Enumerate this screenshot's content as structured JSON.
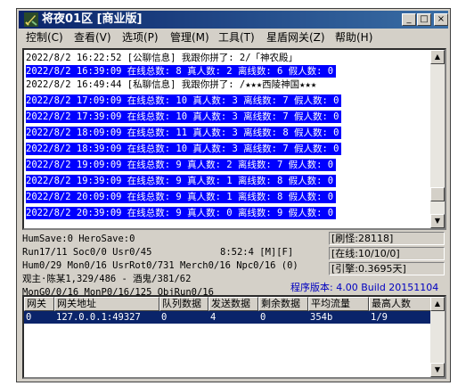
{
  "window": {
    "title": "将夜01区 [商业版]",
    "buttons": {
      "minimize": "_",
      "maximize": "□",
      "close": "×"
    }
  },
  "menu": [
    {
      "label": "控制(C)"
    },
    {
      "label": "查看(V)"
    },
    {
      "label": "选项(P)"
    },
    {
      "label": "管理(M)"
    },
    {
      "label": "工具(T)"
    },
    {
      "label": "星盾网关(Z)"
    },
    {
      "label": "帮助(H)"
    }
  ],
  "log": [
    {
      "text": "2022/8/2 16:22:52 [公聊信息] 我跟你拼了: 2/「神农殿」",
      "selected": false
    },
    {
      "text": "2022/8/2 16:39:09 在线总数: 8 真人数: 2 离线数: 6 假人数: 0",
      "selected": true
    },
    {
      "text": "2022/8/2 16:49:44 [私聊信息] 我跟你拼了: /★★★西陵神国★★★",
      "selected": false
    },
    {
      "text": "2022/8/2 17:09:09 在线总数: 10 真人数: 3 离线数: 7 假人数: 0",
      "selected": true
    },
    {
      "text": "2022/8/2 17:39:09 在线总数: 10 真人数: 3 离线数: 7 假人数: 0",
      "selected": true
    },
    {
      "text": "2022/8/2 18:09:09 在线总数: 11 真人数: 3 离线数: 8 假人数: 0",
      "selected": true
    },
    {
      "text": "2022/8/2 18:39:09 在线总数: 10 真人数: 3 离线数: 7 假人数: 0",
      "selected": true
    },
    {
      "text": "2022/8/2 19:09:09 在线总数: 9 真人数: 2 离线数: 7 假人数: 0",
      "selected": true
    },
    {
      "text": "2022/8/2 19:39:09 在线总数: 9 真人数: 1 离线数: 8 假人数: 0",
      "selected": true
    },
    {
      "text": "2022/8/2 20:09:09 在线总数: 9 真人数: 1 离线数: 8 假人数: 0",
      "selected": true
    },
    {
      "text": "2022/8/2 20:39:09 在线总数: 9 真人数: 0 离线数: 9 假人数: 0",
      "selected": true
    }
  ],
  "status": {
    "line1": "HumSave:0 HeroSave:0",
    "line2a": "Run17/11 Soc0/0 Usr0/45",
    "line2b": "8:52:4 [M][F]",
    "line3": "Hum0/29 Mon0/16 UsrRot0/731 Merch0/16 Npc0/16 (0)",
    "line4": "观主·陈某1,329/486 - 酒鬼/381/62",
    "line5": "MonG0/0/16 MonP0/16/125 ObjRun0/16",
    "monsters": "[刷怪:28118]",
    "online": "[在线:10/10/0]",
    "engine": "[引擎:0.3695天]",
    "version": "程序版本: 4.00 Build 20151104"
  },
  "gateway_table": {
    "columns": [
      "网关",
      "网关地址",
      "队列数据",
      "发送数据",
      "剩余数据",
      "平均流量",
      "最高人数"
    ],
    "rows": [
      [
        "0",
        "127.0.0.1:49327",
        "0",
        "4",
        "0",
        "354b",
        "1/9"
      ]
    ]
  },
  "colors": {
    "title_bar": "#0a246a",
    "selection": "#0000ff",
    "version_text": "#0000c0"
  }
}
